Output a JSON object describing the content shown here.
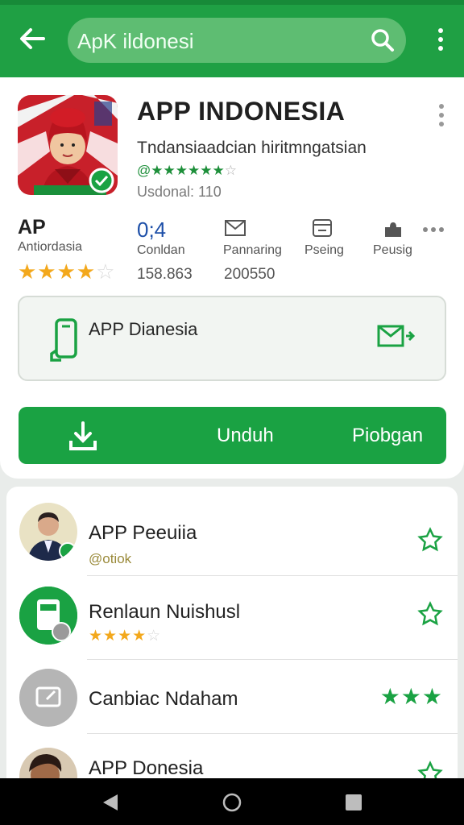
{
  "header": {
    "search_text": "ApK ildonesi"
  },
  "app": {
    "title": "APP INDONESIA",
    "subtitle": "Tndansiaadcian hiritmngatsian",
    "rating_line_on": "@★★★★★★",
    "rating_line_off": "☆",
    "installs": "Usdonal: 110"
  },
  "stats": [
    {
      "big": "AP",
      "label": "Antiordasia",
      "stars_on": "★★★★",
      "stars_off": "☆"
    },
    {
      "big": "0;4",
      "label": "Conldan",
      "number": "158.863"
    },
    {
      "label": "Pannaring",
      "number": "200550"
    },
    {
      "label": "Pseing"
    },
    {
      "label": "Peusig"
    }
  ],
  "info_box": {
    "label": "APP Dianesia"
  },
  "download": {
    "label": "Unduh",
    "label2": "Piobgan"
  },
  "list": [
    {
      "name": "APP Peeuiia",
      "sub": "@otiok"
    },
    {
      "name": "Renlaun Nuishusl",
      "stars_on": "★★★★",
      "stars_off": "☆"
    },
    {
      "name": "Canbiac Ndaham",
      "green_stars": "★★★"
    },
    {
      "name": "APP Donesia"
    }
  ],
  "colors": {
    "brand": "#1fa044",
    "accent_star": "#f3a81c",
    "download_bg": "#1aa243"
  },
  "icons": [
    "back-arrow-icon",
    "search-icon",
    "more-vert-icon",
    "phone-icon",
    "mail-arrow-icon",
    "download-icon",
    "star-outline-icon",
    "nav-back-icon",
    "nav-home-icon",
    "nav-recents-icon"
  ]
}
